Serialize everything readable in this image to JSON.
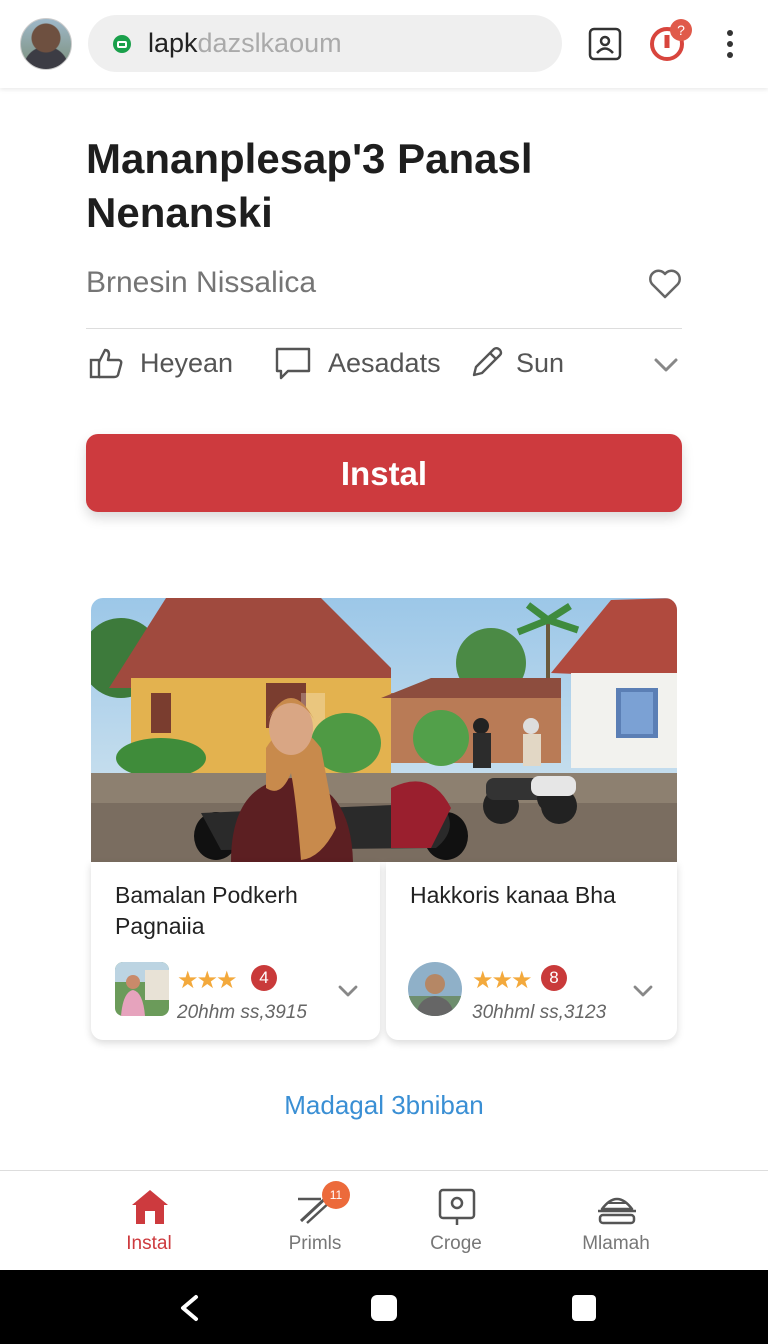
{
  "browser": {
    "url_host": "lapk",
    "url_rest": "dazslkaoum",
    "alert_badge": "?"
  },
  "app": {
    "title": "Mananplesap'3 Panasl Nenanski",
    "subtitle": "Brnesin Nissalica",
    "meta": [
      {
        "icon": "thumbs-up-icon",
        "label": "Heyean"
      },
      {
        "icon": "comment-icon",
        "label": "Aesadats"
      },
      {
        "icon": "pencil-icon",
        "label": "Sun"
      }
    ],
    "install_label": "Instal"
  },
  "cards": [
    {
      "title": "Bamalan Podkerh Pagnaiia",
      "stars": "★★★",
      "badge": "4",
      "meta": "20hhm ss,3915"
    },
    {
      "title": "Hakkoris kanaa Bha",
      "stars": "★★★",
      "badge": "8",
      "meta": "30hhml ss,3123"
    }
  ],
  "more_link": "Madagal 3bniban",
  "bottom_nav": [
    {
      "label": "Instal",
      "icon": "home-icon",
      "active": true
    },
    {
      "label": "Primls",
      "icon": "pen-icon",
      "badge": "11"
    },
    {
      "label": "Croge",
      "icon": "display-icon"
    },
    {
      "label": "Mlamah",
      "icon": "dish-icon"
    }
  ],
  "colors": {
    "accent": "#cd3a3e",
    "link": "#3a8fd4",
    "star": "#f3a93c"
  }
}
